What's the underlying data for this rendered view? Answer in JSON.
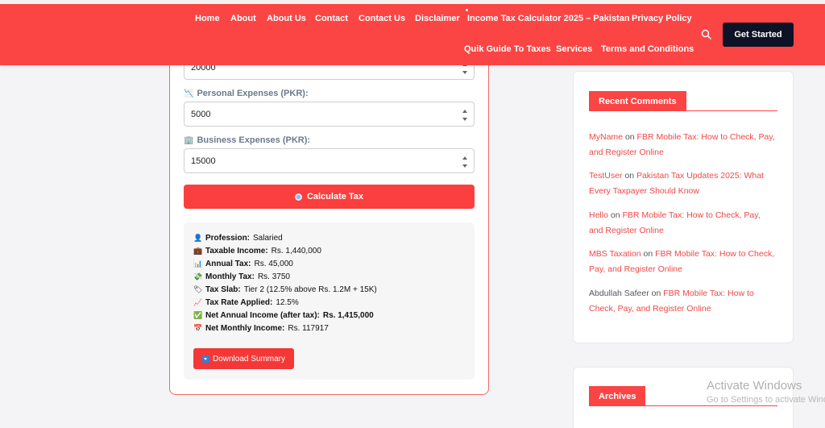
{
  "nav": {
    "items": [
      "Home",
      "About",
      "About Us",
      "Contact",
      "Contact Us",
      "Disclaimer",
      "Income Tax Calculator 2025 – Pakistan",
      "Privacy Policy"
    ],
    "items_row2": [
      "Quik Guide To Taxes",
      "Services",
      "Terms and Conditions"
    ],
    "cta_label": "Get Started"
  },
  "form": {
    "top_value": "20000",
    "personal_label": "Personal Expenses (PKR):",
    "personal_value": "5000",
    "business_label": "Business Expenses (PKR):",
    "business_value": "15000",
    "calc_label": "Calculate Tax"
  },
  "result": {
    "rows": [
      {
        "icon": "👤",
        "label": "Profession:",
        "value": "Salaried"
      },
      {
        "icon": "💼",
        "label": "Taxable Income:",
        "value": "Rs. 1,440,000"
      },
      {
        "icon": "📊",
        "label": "Annual Tax:",
        "value": "Rs. 45,000"
      },
      {
        "icon": "💸",
        "label": "Monthly Tax:",
        "value": "Rs. 3750"
      },
      {
        "icon": "🏷",
        "label": "Tax Slab:",
        "value": "Tier 2 (12.5% above Rs. 1.2M + 15K)"
      },
      {
        "icon": "📈",
        "label": "Tax Rate Applied:",
        "value": "12.5%"
      },
      {
        "icon": "✅",
        "label": "Net Annual Income (after tax):",
        "value": "Rs. 1,415,000"
      },
      {
        "icon": "📅",
        "label": "Net Monthly Income:",
        "value": "Rs. 117917"
      }
    ],
    "download_label": "Download Summary"
  },
  "sidebar": {
    "recent_title": "Recent Comments",
    "comments": [
      {
        "author": "MyName",
        "on": "on",
        "post": "FBR Mobile Tax: How to Check, Pay, and Register Online"
      },
      {
        "author": "TestUser",
        "on": "on",
        "post": "Pakistan Tax Updates 2025: What Every Taxpayer Should Know"
      },
      {
        "author": "Hello",
        "on": "on",
        "post": "FBR Mobile Tax: How to Check, Pay, and Register Online"
      },
      {
        "author": "MBS Taxation",
        "on": "on",
        "post": "FBR Mobile Tax: How to Check, Pay, and Register Online"
      },
      {
        "author": "Abdullah Safeer",
        "on": "on",
        "post": "FBR Mobile Tax: How to Check, Pay, and Register Online"
      }
    ],
    "archives_title": "Archives"
  },
  "watermark": {
    "line1": "Activate Windows",
    "line2": "Go to Settings to activate Windows."
  },
  "colors": {
    "brand": "#fb4444",
    "dark": "#0d1226"
  }
}
